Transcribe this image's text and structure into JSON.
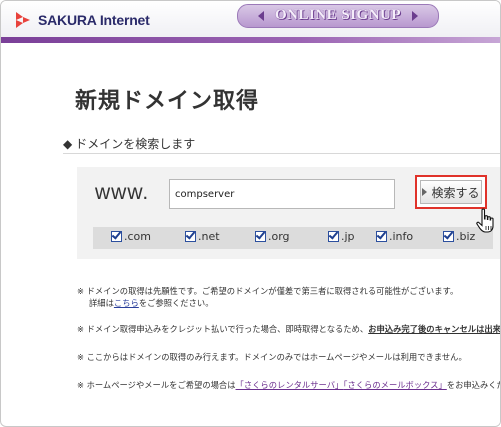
{
  "header": {
    "logo_text": "SAKURA Internet",
    "signup_banner": "ONLINE SIGNUP"
  },
  "page": {
    "title": "新規ドメイン取得",
    "section_label": "ドメインを検索します",
    "section_bullet": "◆"
  },
  "search": {
    "prefix": "www.",
    "input_value": "compserver",
    "button_label": "検索する",
    "tlds": [
      {
        "label": ".com",
        "checked": true
      },
      {
        "label": ".net",
        "checked": true
      },
      {
        "label": ".org",
        "checked": true
      },
      {
        "label": ".jp",
        "checked": true
      },
      {
        "label": ".info",
        "checked": true
      },
      {
        "label": ".biz",
        "checked": true
      }
    ]
  },
  "notes": {
    "n1_line1": "※ ドメインの取得は先願性です。ご希望のドメインが僅差で第三者に取得される可能性がございます。",
    "n1_line2_pre": "詳細は",
    "n1_link": "こちら",
    "n1_line2_post": "をご参照ください。",
    "n2_pre": "※ ドメイン取得申込みをクレジット払いで行った場合、即時取得となるため、",
    "n2_bold": "お申込み完了後のキャンセルは出来かね",
    "n3": "※ ここからはドメインの取得のみ行えます。ドメインのみではホームページやメールは利用できません。",
    "n4_pre": "※ ホームページやメールをご希望の場合は",
    "n4_link1": "「さくらのレンタルサーバ」",
    "n4_link2": "「さくらのメールボックス」",
    "n4_post": "をお申込みくださ"
  },
  "colors": {
    "brand_purple": "#7a3f98",
    "highlight_red": "#e0322a",
    "link_blue": "#2a3f9b"
  },
  "icons": {
    "logo": "sakura-logo-icon",
    "cursor": "hand-pointer-icon",
    "button_arrow": "triangle-right-icon"
  }
}
